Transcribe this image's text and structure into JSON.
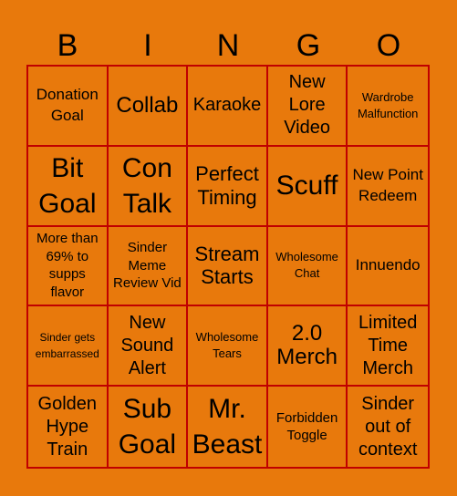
{
  "header": {
    "letters": [
      "B",
      "I",
      "N",
      "G",
      "O"
    ]
  },
  "colors": {
    "background": "#E8790C",
    "grid": "#C00000",
    "text": "#000000"
  },
  "cells": [
    {
      "text": "Donation Goal",
      "size": "s-sm"
    },
    {
      "text": "Collab",
      "size": "s-l"
    },
    {
      "text": "Karaoke",
      "size": "s-m"
    },
    {
      "text": "New Lore Video",
      "size": "s-m"
    },
    {
      "text": "Wardrobe Malfunction",
      "size": "s-xs"
    },
    {
      "text": "Bit Goal",
      "size": "s-xl"
    },
    {
      "text": "Con Talk",
      "size": "s-xl"
    },
    {
      "text": "Perfect Timing",
      "size": "s-ml"
    },
    {
      "text": "Scuff",
      "size": "s-xl"
    },
    {
      "text": "New Point Redeem",
      "size": "s-sm"
    },
    {
      "text": "More than 69% to supps flavor",
      "size": "s-s"
    },
    {
      "text": "Sinder Meme Review Vid",
      "size": "s-s"
    },
    {
      "text": "Stream Starts",
      "size": "s-ml"
    },
    {
      "text": "Wholesome Chat",
      "size": "s-xs"
    },
    {
      "text": "Innuendo",
      "size": "s-sm"
    },
    {
      "text": "Sinder gets embarrassed",
      "size": "s-xxs"
    },
    {
      "text": "New Sound Alert",
      "size": "s-m"
    },
    {
      "text": "Wholesome Tears",
      "size": "s-xs"
    },
    {
      "text": "2.0 Merch",
      "size": "s-l"
    },
    {
      "text": "Limited Time Merch",
      "size": "s-m"
    },
    {
      "text": "Golden Hype Train",
      "size": "s-m"
    },
    {
      "text": "Sub Goal",
      "size": "s-xl"
    },
    {
      "text": "Mr. Beast",
      "size": "s-xl"
    },
    {
      "text": "Forbidden Toggle",
      "size": "s-s"
    },
    {
      "text": "Sinder out of context",
      "size": "s-m"
    }
  ]
}
